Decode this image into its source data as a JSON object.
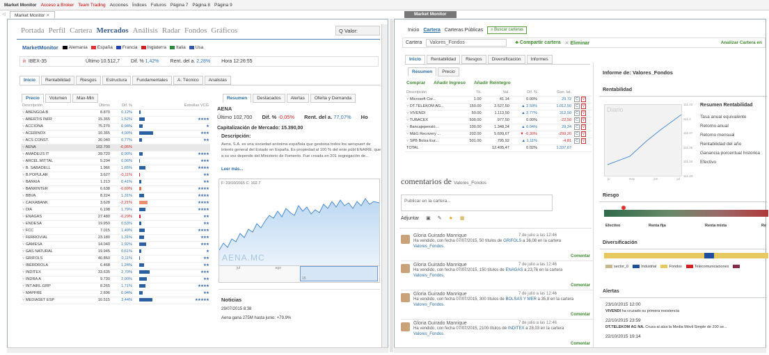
{
  "topnav": {
    "items": [
      "Market Monitor",
      "Acceso a Broker",
      "Team Trading",
      "Acciones",
      "Índices",
      "Futuros",
      "Página 7",
      "Página 8",
      "Página 9"
    ]
  },
  "left": {
    "tab": "Market Monitor",
    "nav": [
      "Portada",
      "Perfil",
      "Cartera",
      "Mercados",
      "Análisis",
      "Radar",
      "Fondos",
      "Gráficos"
    ],
    "search_label": "Q Valor:",
    "brand": "MarketMonitor",
    "flags": [
      {
        "name": "Alemania",
        "color": "#000"
      },
      {
        "name": "España",
        "color": "#d33"
      },
      {
        "name": "Francia",
        "color": "#2244aa"
      },
      {
        "name": "Inglaterra",
        "color": "#c22"
      },
      {
        "name": "Italia",
        "color": "#2a8a3a"
      },
      {
        "name": "Usa",
        "color": "#3355aa"
      }
    ],
    "index": {
      "name": "IBEX-35",
      "last": "Último 10.512,7",
      "dif_label": "Dif. % ",
      "dif": "1,42%",
      "rent_label": "Rent. del a. ",
      "rent": "2,28%",
      "hora": "Hora 12:26:55"
    },
    "subtabs": [
      "Inicio",
      "Rentabilidad",
      "Riesgos",
      "Estructura",
      "Fundamentales",
      "A. Técnico",
      "Analistas"
    ],
    "pricetabs": [
      "Precio",
      "Volumen",
      "Max-Min"
    ],
    "cols": [
      "Descripción",
      "Último",
      "Dif. %",
      "Estrellas VCG"
    ],
    "stocks": [
      {
        "n": "ABENGOA B",
        "l": "8.870",
        "d": "0,12%",
        "bw": 2,
        "bc": "#2a5fa0",
        "s": ""
      },
      {
        "n": "ABERTIS INFR",
        "l": "15.365",
        "d": "1,52%",
        "bw": 8,
        "bc": "#2a5fa0",
        "s": "★★★★"
      },
      {
        "n": "ACCIONA",
        "l": "75.270",
        "d": "0,94%",
        "bw": 5,
        "bc": "#2a5fa0",
        "s": "★"
      },
      {
        "n": "ACERINOX",
        "l": "10.365",
        "d": "4,00%",
        "bw": 20,
        "bc": "#2a5fa0",
        "s": "★★★"
      },
      {
        "n": "ACS CONST.",
        "l": "30.040",
        "d": "0,77%",
        "bw": 4,
        "bc": "#2a5fa0",
        "s": "★★"
      },
      {
        "n": "AENA",
        "l": "102.700",
        "d": "-0,05%",
        "bw": 0,
        "bc": "#e07050",
        "s": "",
        "sel": true
      },
      {
        "n": "AMADEUS IT",
        "l": "39.720",
        "d": "0,90%",
        "bw": 5,
        "bc": "#2a5fa0",
        "s": "★★★★"
      },
      {
        "n": "ARCEL.MITTAL",
        "l": "5.294",
        "d": "0,06%",
        "bw": 1,
        "bc": "#2a5fa0",
        "s": "★★★"
      },
      {
        "n": "B. SABADELL",
        "l": "1.966",
        "d": "1,65%",
        "bw": 9,
        "bc": "#2a5fa0",
        "s": "★★★★"
      },
      {
        "n": "B.POPULAR",
        "l": "3.627",
        "d": "-0,11%",
        "bw": 1,
        "bc": "#d23",
        "s": "★★"
      },
      {
        "n": "BANKIA",
        "l": "1.213",
        "d": "0,41%",
        "bw": 3,
        "bc": "#2a5fa0",
        "s": "★★"
      },
      {
        "n": "BANKINTER",
        "l": "6.638",
        "d": "-0,69%",
        "bw": 3,
        "bc": "#e07050",
        "s": "★★★★"
      },
      {
        "n": "BBVA",
        "l": "8.224",
        "d": "1,31%",
        "bw": 7,
        "bc": "#2a5fa0",
        "s": "★★★★"
      },
      {
        "n": "CAIXABANK",
        "l": "3.628",
        "d": "-2,21%",
        "bw": 12,
        "bc": "#e89070",
        "s": "★★★★"
      },
      {
        "n": "DIA",
        "l": "6.198",
        "d": "1,79%",
        "bw": 9,
        "bc": "#2a5fa0",
        "s": "★★★★"
      },
      {
        "n": "ENAGAS",
        "l": "27.480",
        "d": "-0,29%",
        "bw": 2,
        "bc": "#d23",
        "s": "★★"
      },
      {
        "n": "ENDESA",
        "l": "19.950",
        "d": "0,53%",
        "bw": 3,
        "bc": "#2a5fa0",
        "s": "★★"
      },
      {
        "n": "FCC",
        "l": "7.015",
        "d": "1,49%",
        "bw": 8,
        "bc": "#2a5fa0",
        "s": "★★★★"
      },
      {
        "n": "FERROVIAL",
        "l": "23.180",
        "d": "1,31%",
        "bw": 7,
        "bc": "#2a5fa0",
        "s": "★★★"
      },
      {
        "n": "GAMESA",
        "l": "14.040",
        "d": "1,92%",
        "bw": 10,
        "bc": "#2a5fa0",
        "s": "★★★"
      },
      {
        "n": "GAS NATURAL",
        "l": "19.945",
        "d": "0,61%",
        "bw": 3,
        "bc": "#2a5fa0",
        "s": "★"
      },
      {
        "n": "GRIFOLS",
        "l": "40.860",
        "d": "0,11%",
        "bw": 1,
        "bc": "#2a5fa0",
        "s": "★★"
      },
      {
        "n": "IBERDROLA",
        "l": "6.468",
        "d": "1,24%",
        "bw": 7,
        "bc": "#2a5fa0",
        "s": "★★"
      },
      {
        "n": "INDITEX",
        "l": "33.635",
        "d": "2,70%",
        "bw": 15,
        "bc": "#2a5fa0",
        "s": "★★★"
      },
      {
        "n": "INDRA A",
        "l": "9.730",
        "d": "2,00%",
        "bw": 11,
        "bc": "#2a5fa0",
        "s": "★★"
      },
      {
        "n": "INT.AIRL.GRP",
        "l": "8.265",
        "d": "1,71%",
        "bw": 9,
        "bc": "#2a5fa0",
        "s": "★★★★"
      },
      {
        "n": "MAPFRE",
        "l": "2.696",
        "d": "0,94%",
        "bw": 5,
        "bc": "#2a5fa0",
        "s": "★★"
      },
      {
        "n": "MEDIASET ESP",
        "l": "10.515",
        "d": "3,44%",
        "bw": 19,
        "bc": "#2a5fa0",
        "s": "★★★★★"
      }
    ],
    "detail": {
      "tabs": [
        "Resumen",
        "Destacados",
        "Alertas",
        "Oferta y Demanda"
      ],
      "name": "AENA",
      "last": "Último 102,700",
      "dif_label": "Dif. % ",
      "dif": "-0,05%",
      "rent_label": "Rent. del a. ",
      "rent": "77,07%",
      "ho": "Ho",
      "cap": "Capitalización de Mercado: 15.390,00",
      "desc_title": "Descripción:",
      "desc": "Aena, S.A. es una sociedad anónima española que gestiona todos los aeropuert de interés general del Estado en España. Es propiedad al 100 % del ente públ ENAIRE, que a su vez depende del Ministerio de Fomento. Fue creada en 201 segregación de...",
      "leer": "Leer más...",
      "chart_label": "F: 23/10/2015 C: 102.7",
      "watermark": "AENA.MC",
      "nav_months": [
        "jul",
        "ago",
        "sep",
        "oct"
      ],
      "nav_sel": "15",
      "news_title": "Noticias",
      "news_date": "29/07/2015 8:38",
      "news_text": "Aena gana 275M hasta junio: +79.9%"
    }
  },
  "right": {
    "tab": "Market Monitor",
    "nav": [
      "Inicio",
      "Cartera",
      "Carteras Públicas"
    ],
    "search_btn": "Buscar carteras",
    "cartera_label": "Cartera",
    "cartera_value": "Valores_Fondos",
    "share": "Compartir cartera",
    "delete": "Eliminar",
    "analyze": "Analizar Cartera en",
    "subtabs": [
      "Inicio",
      "Rentabilidad",
      "Riesgos",
      "Diversificación",
      "Informes"
    ],
    "restabs": [
      "Resumen",
      "Precio"
    ],
    "actions": [
      "Comprar",
      "Añadir Ingreso",
      "Añadir Reintegro"
    ],
    "cols": [
      "Descripción",
      "Tit.",
      "Val.",
      "Dif. %",
      "Gan. lat."
    ],
    "rows": [
      {
        "n": "Microsoft Cor...",
        "t": "1.00",
        "v": "41.14",
        "d": "0.00%",
        "g": "29.72",
        "dir": ""
      },
      {
        "n": "DT.TELEKOM AG...",
        "t": "150.00",
        "v": "2.527,50",
        "d": "2.59%",
        "g": "1.012,50",
        "dir": "up"
      },
      {
        "n": "VIVENDI",
        "t": "50.00",
        "v": "1.113,50",
        "d": "2.77%",
        "g": "312,50",
        "dir": "up"
      },
      {
        "n": "TUBACEX",
        "t": "500.00",
        "v": "977,50",
        "d": "0.00%",
        "g": "-22,50",
        "dir": ""
      },
      {
        "n": "Bancajepensió...",
        "t": "100.00",
        "v": "1.348,24",
        "d": "0.04%",
        "g": "29,24",
        "dir": "up"
      },
      {
        "n": "M&G Recovery ...",
        "t": "202.00",
        "v": "5.699,67",
        "d": "-0,30%",
        "g": "-299,20",
        "dir": "down"
      },
      {
        "n": "SPB Bolsa Eur...",
        "t": "501.00",
        "v": "795,92",
        "d": "1,11%",
        "g": "-4,81",
        "dir": "up"
      }
    ],
    "total": {
      "n": "TOTAL",
      "v": "12.495,47",
      "d": "0.02%",
      "g": "1.337,67"
    },
    "comments_title": "comentarios de",
    "comments_sub": "Valores_Fondos",
    "publish_placeholder": "Publicar en la cartera...",
    "adjuntar": "Adjuntar",
    "comments": [
      {
        "name": "Gloria Guirado Manrique",
        "date": "7 de julio a las 12:46",
        "pre": "Ha vendido, con fecha 07/07/2015, 50 títulos de ",
        "link": "GRIFOLS",
        "post": " a 36,08 en la cartera",
        "port": "Valores_Fondos."
      },
      {
        "name": "Gloria Guirado Manrique",
        "date": "7 de julio a las 12:46",
        "pre": "Ha vendido, con fecha 07/07/2015, 150 títulos de ",
        "link": "ENAGAS",
        "post": " a 23,76 en la cartera",
        "port": "Valores_Fondos."
      },
      {
        "name": "Gloria Guirado Manrique",
        "date": "7 de julio a las 12:46",
        "pre": "Ha vendido, con fecha 07/07/2015, 300 títulos de ",
        "link": "BOLSAS Y MER",
        "post": " a 35,8 en la cartera",
        "port": "Valores_Fondos."
      },
      {
        "name": "Gloria Guirado Manrique",
        "date": "7 de julio a las 12:46",
        "pre": "Ha vendido, con fecha 07/07/2015, 2100 títulos de ",
        "link": "INDITEX",
        "post": " a 28,03 en la cartera",
        "port": "Valores_Fondos."
      }
    ],
    "comentar": "Comentar",
    "informe_label": "Informe de:",
    "informe_value": "Valores_Fondos",
    "rent_title": "Rentabilidad",
    "diario": "Diario",
    "rent_summary_title": "Resumen Rentabilidad",
    "rent_summary": [
      "Tasa anual equivalente",
      "Retorno anual",
      "Retorno mensual",
      "Rentabilidad del año",
      "Ganancia porcentual historica",
      "Efectivo"
    ],
    "rent_axis": [
      "111.43",
      "111.4",
      "111.37",
      "111.36",
      "111.34",
      "111.33"
    ],
    "rent_x": [
      "ju",
      "may",
      "jun",
      "jul"
    ],
    "riesgo_title": "Riesgo",
    "riesgo_labels": [
      "Efectivo",
      "Renta fija",
      "Renta mixta",
      "Re"
    ],
    "div_title": "Diversificación",
    "div_legend": [
      {
        "n": "sector_0",
        "c": "#c8b890"
      },
      {
        "n": "Industrial",
        "c": "#1f4e9a"
      },
      {
        "n": "Fondos",
        "c": "#e8c860"
      },
      {
        "n": "Telecomunicaciones",
        "c": "#d02020"
      }
    ],
    "alertas_title": "Alertas",
    "alerts": [
      {
        "date": "23/10/2015 12:00",
        "b": "VIVENDI",
        "t": " ha cruzado su primera resistencia"
      },
      {
        "date": "22/10/2015 23:59",
        "b": "DT.TELEKOM AG NA.",
        "t": " Cruza al alza la Media Móvil Simple de 200 se..."
      },
      {
        "date": "22/10/2015 19:14",
        "b": "",
        "t": ""
      }
    ]
  }
}
